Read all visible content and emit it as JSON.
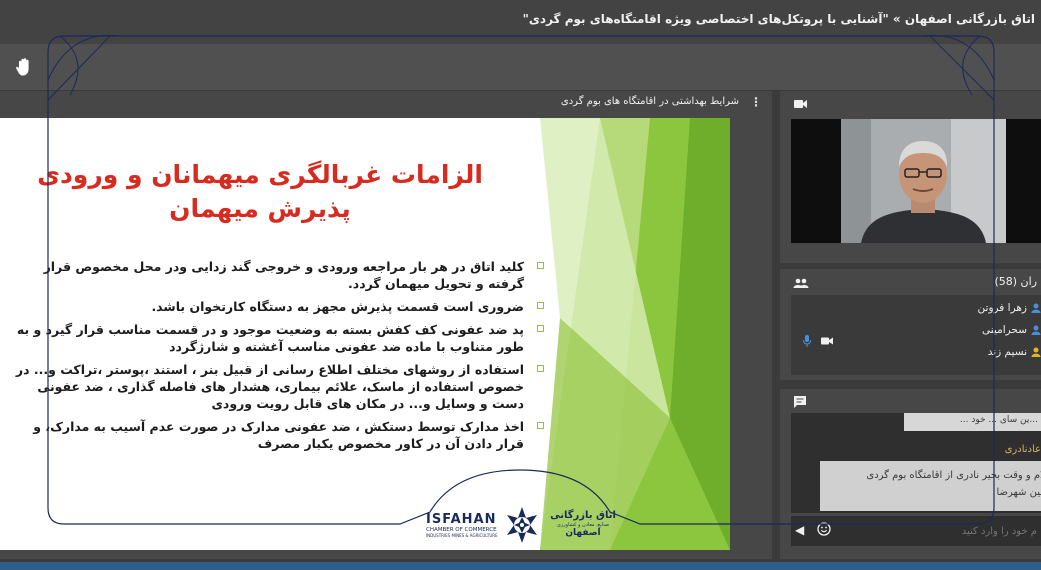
{
  "window": {
    "title": "اتاق بازرگانی اصفهان » \"آشنایی با پروتکل‌های اختصاصی ویژه اقامتگاه‌های بوم گردی\""
  },
  "share_pod": {
    "title": "شرایط بهداشتی در اقامتگاه های بوم گردی",
    "menu_glyph": "⋮"
  },
  "slide": {
    "heading_line1": "الزامات غربالگری میهمانان و ورودی",
    "heading_line2": "پذیرش میهمان",
    "bullets": [
      "کلید اتاق در هر بار مراجعه ورودی و خروجی گند زدایی ودر محل مخصوص قرار گرفته و تحویل میهمان گردد.",
      "ضروری است قسمت پذیرش مجهز به دستگاه کارتخوان باشد.",
      "پد ضد عفونی کف کفش بسته به وضعیت موجود و در قسمت مناسب قرار گیرد و به طور متناوب با ماده ضد عفونی مناسب آغشته و شارژگردد",
      "استفاده از روشهای مختلف اطلاع رسانی از قبیل بنر ، استند ،پوستر ،تراکت و... در خصوص استفاده از ماسک، علائم بیماری، هشدار های فاصله گذاری ، ضد عفونی دست و وسایل و... در مکان های قابل رویت ورودی",
      "اخذ مدارک توسط دستکش ، ضد عفونی مدارک در صورت عدم آسیب به مدارک، و قرار دادن آن در کاور مخصوص یکبار مصرف"
    ],
    "logo": {
      "en_name": "ISFAHAN",
      "en_sub": "CHAMBER OF COMMERCE",
      "en_sub2": "INDUSTRIES MINES & AGRICULTURE",
      "fa_name": "اتاق بازرگانی",
      "fa_sub": "صنایع، معادن و کشاورزی",
      "fa_city": "اصفهان"
    }
  },
  "attendees_pod": {
    "count_label": "ران (58)",
    "people": [
      "زهرا فروتن",
      "سحرامینی",
      "نسیم زند"
    ]
  },
  "chat_pod": {
    "message1_fragment": "...ین سای ... خود ...",
    "sender": "عادنادری",
    "message2_line1": "علام و وقت بخیر نادری از اقامتگاه بوم گردی",
    "message2_line2": "نشین شهرضا",
    "input_placeholder": "م خود را وارد کنید",
    "send_glyph": "◀"
  },
  "colors": {
    "heading_red": "#d72b1f",
    "slide_green": "#8cc63f",
    "logo_navy": "#1a2a5a",
    "attendee_icon_blue": "#4a90d9",
    "attendee_icon_yellow": "#e2b52a",
    "bottom_bar": "#2d5f89"
  },
  "icons": {
    "hand": "raise-hand-icon",
    "camera": "camera-icon",
    "attendees": "people-icon",
    "chat": "chat-bubble-icon",
    "mic": "microphone-icon",
    "video": "video-icon",
    "send": "send-icon",
    "emoji": "emoji-icon"
  }
}
